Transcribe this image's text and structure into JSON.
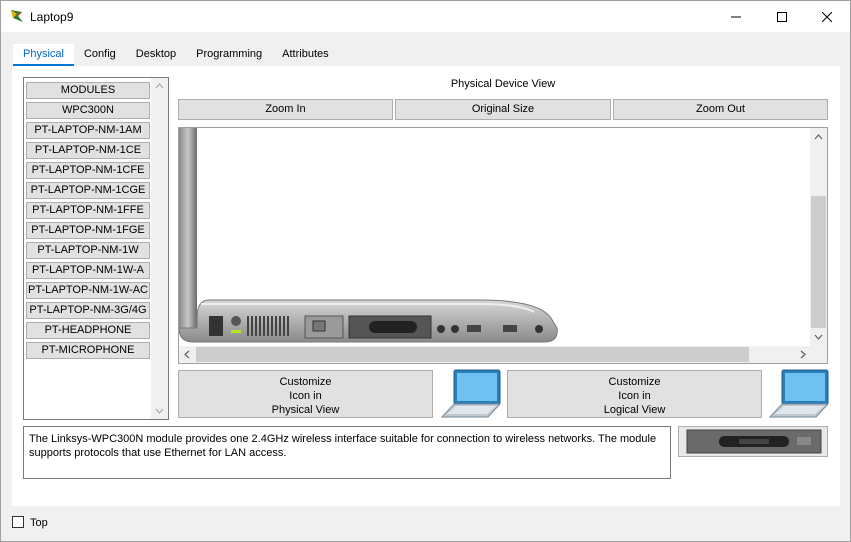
{
  "window": {
    "title": "Laptop9",
    "minimize": "—",
    "maximize": "☐",
    "close": "✕"
  },
  "tabs": [
    {
      "label": "Physical",
      "active": true
    },
    {
      "label": "Config",
      "active": false
    },
    {
      "label": "Desktop",
      "active": false
    },
    {
      "label": "Programming",
      "active": false
    },
    {
      "label": "Attributes",
      "active": false
    }
  ],
  "modules": {
    "header": "MODULES",
    "items": [
      "WPC300N",
      "PT-LAPTOP-NM-1AM",
      "PT-LAPTOP-NM-1CE",
      "PT-LAPTOP-NM-1CFE",
      "PT-LAPTOP-NM-1CGE",
      "PT-LAPTOP-NM-1FFE",
      "PT-LAPTOP-NM-1FGE",
      "PT-LAPTOP-NM-1W",
      "PT-LAPTOP-NM-1W-A",
      "PT-LAPTOP-NM-1W-AC",
      "PT-LAPTOP-NM-3G/4G",
      "PT-HEADPHONE",
      "PT-MICROPHONE"
    ]
  },
  "view": {
    "label": "Physical Device View",
    "zoom_in": "Zoom In",
    "original_size": "Original Size",
    "zoom_out": "Zoom Out"
  },
  "customize": {
    "physical_line1": "Customize",
    "physical_line2": "Icon in",
    "physical_line3": "Physical View",
    "logical_line1": "Customize",
    "logical_line2": "Icon in",
    "logical_line3": "Logical View"
  },
  "description": "The Linksys-WPC300N module provides one 2.4GHz wireless interface suitable for connection to wireless networks. The module supports protocols that use Ethernet for LAN access.",
  "footer": {
    "top_label": "Top",
    "top_checked": false
  },
  "icons": {
    "app": "packet-tracer-icon",
    "laptop": "laptop-icon"
  },
  "colors": {
    "accent": "#0078d7",
    "tab_active_text": "#0066cc"
  }
}
